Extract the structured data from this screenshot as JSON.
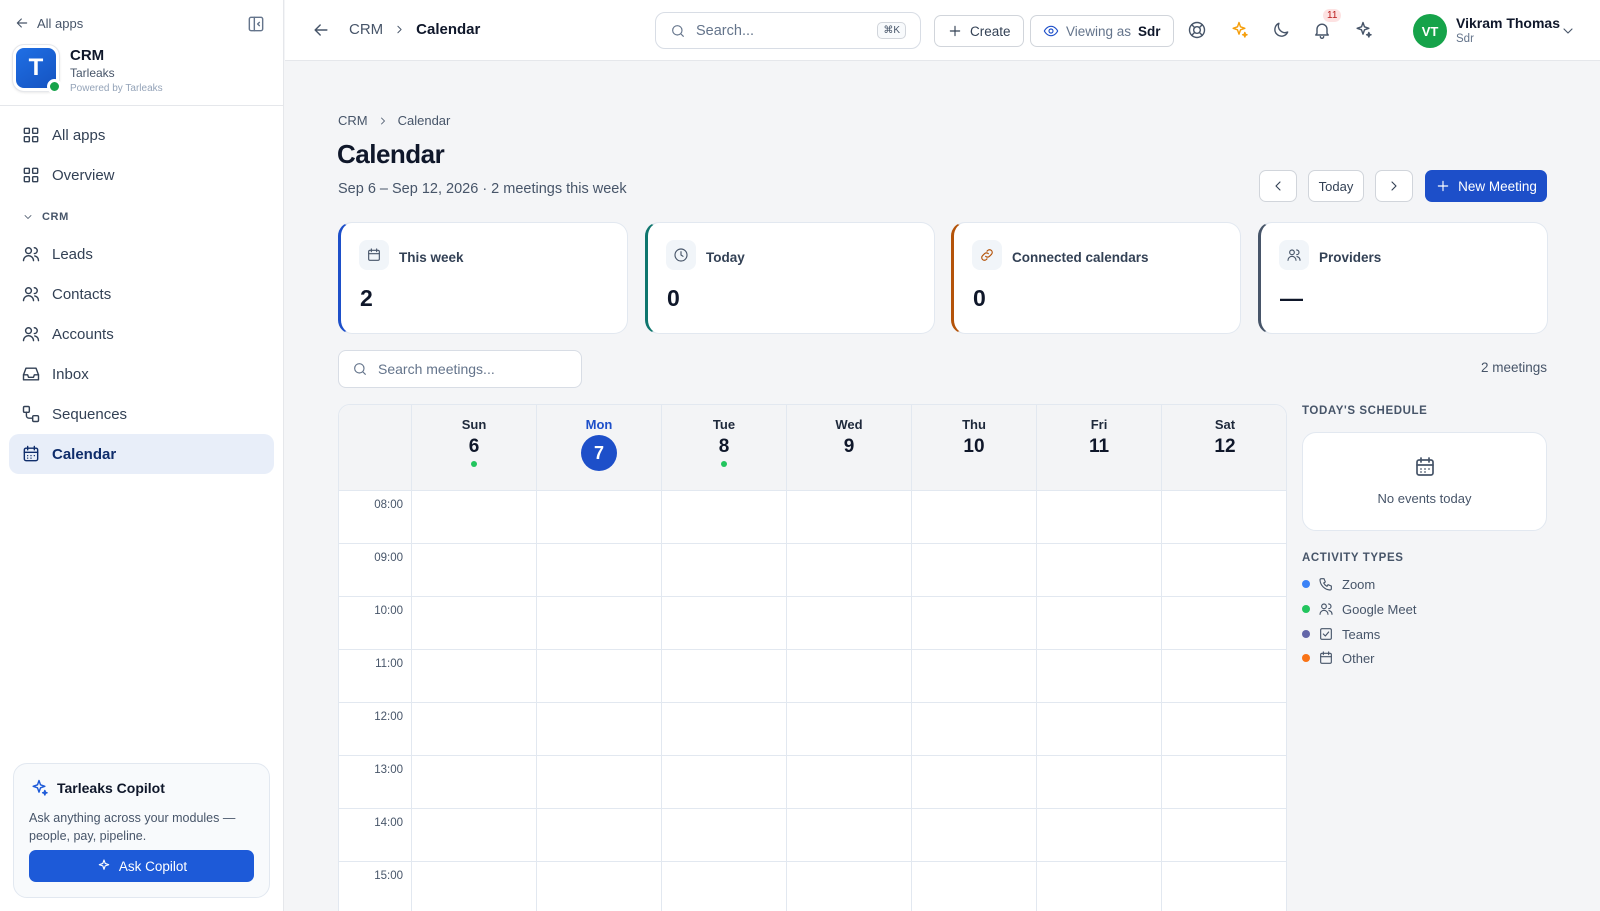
{
  "sidebar": {
    "all_apps": "All apps",
    "brand": {
      "logo_letter": "T",
      "name": "CRM",
      "org": "Tarleaks",
      "powered": "Powered by Tarleaks"
    },
    "top_items": [
      {
        "label": "All apps",
        "icon": "grid-icon"
      },
      {
        "label": "Overview",
        "icon": "grid-icon"
      }
    ],
    "section_label": "CRM",
    "crm_items": [
      {
        "label": "Leads",
        "icon": "users-icon"
      },
      {
        "label": "Contacts",
        "icon": "users-icon"
      },
      {
        "label": "Accounts",
        "icon": "users-icon"
      },
      {
        "label": "Inbox",
        "icon": "inbox-icon"
      },
      {
        "label": "Sequences",
        "icon": "sequence-icon"
      },
      {
        "label": "Calendar",
        "icon": "calendar-icon",
        "active": true
      }
    ],
    "copilot": {
      "title": "Tarleaks Copilot",
      "description": "Ask anything across your modules — people, pay, pipeline.",
      "button": "Ask Copilot"
    }
  },
  "topbar": {
    "breadcrumb": [
      "CRM",
      "Calendar"
    ],
    "search_placeholder": "Search...",
    "search_shortcut": "⌘K",
    "create_label": "Create",
    "viewing_as_label": "Viewing as",
    "viewing_as_role": "Sdr",
    "notification_count": "11",
    "user": {
      "initials": "VT",
      "name": "Vikram Thomas",
      "role": "Sdr"
    }
  },
  "page": {
    "breadcrumb": [
      "CRM",
      "Calendar"
    ],
    "title": "Calendar",
    "subtitle": "Sep 6 – Sep 12, 2026 · 2 meetings this week",
    "today_label": "Today",
    "new_meeting_label": "New Meeting",
    "stats": [
      {
        "label": "This week",
        "value": "2",
        "icon": "calendar-icon",
        "accent": "#1d4fc9"
      },
      {
        "label": "Today",
        "value": "0",
        "icon": "clock-icon",
        "accent": "#0f766e"
      },
      {
        "label": "Connected calendars",
        "value": "0",
        "icon": "link-icon",
        "accent": "#b45309"
      },
      {
        "label": "Providers",
        "value": "—",
        "icon": "users-icon",
        "accent": "#475569"
      }
    ],
    "search_meetings_placeholder": "Search meetings...",
    "meetings_count": "2 meetings"
  },
  "calendar": {
    "days": [
      {
        "name": "Sun",
        "num": "6",
        "has_event": true,
        "today": false
      },
      {
        "name": "Mon",
        "num": "7",
        "has_event": false,
        "today": true
      },
      {
        "name": "Tue",
        "num": "8",
        "has_event": true,
        "today": false
      },
      {
        "name": "Wed",
        "num": "9",
        "has_event": false,
        "today": false
      },
      {
        "name": "Thu",
        "num": "10",
        "has_event": false,
        "today": false
      },
      {
        "name": "Fri",
        "num": "11",
        "has_event": false,
        "today": false
      },
      {
        "name": "Sat",
        "num": "12",
        "has_event": false,
        "today": false
      }
    ],
    "hours": [
      "08:00",
      "09:00",
      "10:00",
      "11:00",
      "12:00",
      "13:00",
      "14:00",
      "15:00"
    ]
  },
  "panel": {
    "schedule_heading": "TODAY'S SCHEDULE",
    "no_events": "No events today",
    "activity_heading": "ACTIVITY TYPES",
    "activity_types": [
      {
        "label": "Zoom",
        "color": "#3b82f6",
        "icon": "phone-icon"
      },
      {
        "label": "Google Meet",
        "color": "#22c55e",
        "icon": "users-icon"
      },
      {
        "label": "Teams",
        "color": "#6366a8",
        "icon": "checkbox-icon"
      },
      {
        "label": "Other",
        "color": "#f97316",
        "icon": "calendar-icon"
      }
    ]
  }
}
